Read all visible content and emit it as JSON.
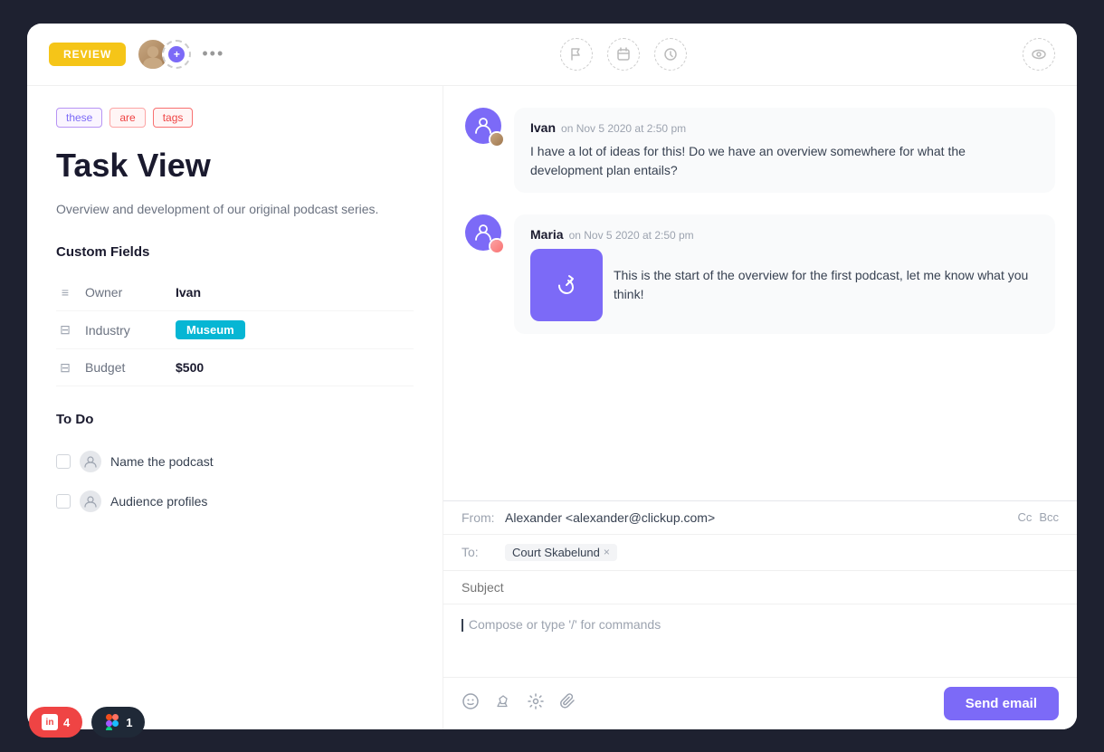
{
  "window": {
    "title": "Task View"
  },
  "top_bar": {
    "review_label": "REVIEW",
    "more_label": "•••",
    "add_icon": "+",
    "icons": [
      "flag",
      "calendar",
      "clock"
    ],
    "eye_icon": "eye"
  },
  "left_panel": {
    "tags": [
      {
        "label": "these",
        "class": "tag-these"
      },
      {
        "label": "are",
        "class": "tag-are"
      },
      {
        "label": "tags",
        "class": "tag-tags"
      }
    ],
    "title": "Task View",
    "description": "Overview and development of our original podcast series.",
    "custom_fields_heading": "Custom Fields",
    "fields": [
      {
        "icon": "≡",
        "label": "Owner",
        "value": "Ivan",
        "type": "text"
      },
      {
        "icon": "⊟",
        "label": "Industry",
        "value": "Museum",
        "type": "badge"
      },
      {
        "icon": "⊟",
        "label": "Budget",
        "value": "$500",
        "type": "text"
      }
    ],
    "todo_heading": "To Do",
    "todos": [
      {
        "text": "Name the podcast"
      },
      {
        "text": "Audience profiles"
      }
    ]
  },
  "comments": [
    {
      "author": "Ivan",
      "time": "on Nov 5 2020 at 2:50 pm",
      "text": "I have a lot of ideas for this! Do we have an overview somewhere for what the development plan entails?",
      "has_attachment": false
    },
    {
      "author": "Maria",
      "time": "on Nov 5 2020 at 2:50 pm",
      "text": "This is the start of the overview for the first podcast, let me know what you think!",
      "has_attachment": true
    }
  ],
  "email_compose": {
    "from_label": "From:",
    "from_value": "Alexander <alexander@clickup.com>",
    "cc_label": "Cc",
    "bcc_label": "Bcc",
    "to_label": "To:",
    "to_recipient": "Court Skabelund",
    "to_remove": "×",
    "subject_placeholder": "Subject",
    "body_placeholder": "Compose or type '/' for commands",
    "send_label": "Send email"
  },
  "bottom_bar": {
    "badge1_count": "4",
    "badge2_count": "1"
  }
}
